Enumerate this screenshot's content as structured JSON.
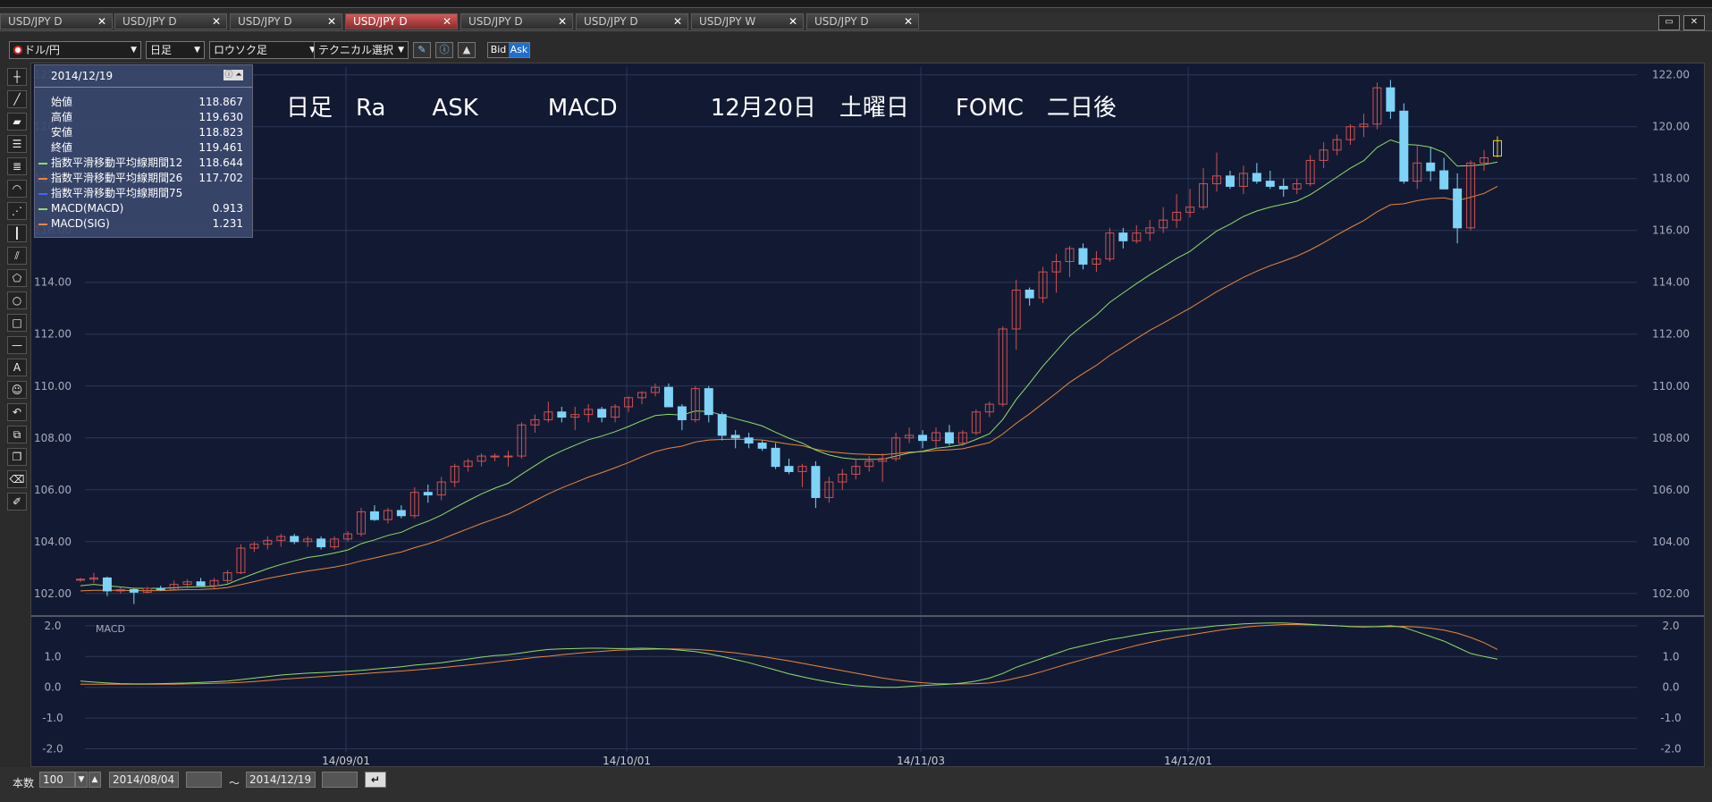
{
  "tabs": [
    {
      "label": "USD/JPY D",
      "active": false
    },
    {
      "label": "USD/JPY D",
      "active": false
    },
    {
      "label": "USD/JPY D",
      "active": false
    },
    {
      "label": "USD/JPY D",
      "active": true
    },
    {
      "label": "USD/JPY D",
      "active": false
    },
    {
      "label": "USD/JPY D",
      "active": false
    },
    {
      "label": "USD/JPY W",
      "active": false
    },
    {
      "label": "USD/JPY D",
      "active": false
    }
  ],
  "toolbar": {
    "pair": "ドル/円",
    "period": "日足",
    "chart_style": "ロウソク足",
    "technical": "テクニカル選択",
    "bid": "Bid",
    "ask": "Ask"
  },
  "info": {
    "date": "2014/12/19",
    "rows": [
      {
        "label": "始値",
        "value": "118.867",
        "color": ""
      },
      {
        "label": "高値",
        "value": "119.630",
        "color": ""
      },
      {
        "label": "安値",
        "value": "118.823",
        "color": ""
      },
      {
        "label": "終値",
        "value": "119.461",
        "color": ""
      },
      {
        "label": "指数平滑移動平均線期間12",
        "value": "118.644",
        "color": "#8fdc6a"
      },
      {
        "label": "指数平滑移動平均線期間26",
        "value": "117.702",
        "color": "#e8873a"
      },
      {
        "label": "指数平滑移動平均線期間75",
        "value": "",
        "color": "#4466ee"
      },
      {
        "label": "MACD(MACD)",
        "value": "0.913",
        "color": "#8fdc6a"
      },
      {
        "label": "MACD(SIG)",
        "value": "1.231",
        "color": "#e8873a"
      }
    ]
  },
  "annotation": "日足　Ra　　ASK　　　MACD　　　　12月20日　土曜日　　FOMC　二日後",
  "chart_data": {
    "type": "candlestick",
    "y_ticks": [
      "122.00",
      "120.00",
      "118.00",
      "116.00",
      "114.00",
      "112.00",
      "110.00",
      "108.00",
      "106.00",
      "104.00",
      "102.00"
    ],
    "ylim": [
      101.2,
      122.3
    ],
    "x_labels": [
      "14/09/01",
      "14/10/01",
      "14/11/03",
      "14/12/01"
    ],
    "candles": [
      [
        102.55,
        102.6,
        102.45,
        102.55
      ],
      [
        102.55,
        102.8,
        102.4,
        102.6
      ],
      [
        102.6,
        102.65,
        101.9,
        102.1
      ],
      [
        102.1,
        102.25,
        102.0,
        102.15
      ],
      [
        102.15,
        102.2,
        101.6,
        102.05
      ],
      [
        102.05,
        102.25,
        102.0,
        102.2
      ],
      [
        102.2,
        102.3,
        102.1,
        102.15
      ],
      [
        102.15,
        102.5,
        102.1,
        102.35
      ],
      [
        102.35,
        102.55,
        102.2,
        102.45
      ],
      [
        102.45,
        102.6,
        102.3,
        102.3
      ],
      [
        102.3,
        102.6,
        102.2,
        102.5
      ],
      [
        102.5,
        102.9,
        102.4,
        102.8
      ],
      [
        102.8,
        103.9,
        102.75,
        103.75
      ],
      [
        103.75,
        104.0,
        103.6,
        103.9
      ],
      [
        103.9,
        104.2,
        103.7,
        104.05
      ],
      [
        104.05,
        104.3,
        103.8,
        104.2
      ],
      [
        104.2,
        104.3,
        103.9,
        104.0
      ],
      [
        104.0,
        104.2,
        103.8,
        104.1
      ],
      [
        104.1,
        104.2,
        103.7,
        103.8
      ],
      [
        103.8,
        104.2,
        103.7,
        104.1
      ],
      [
        104.1,
        104.4,
        104.0,
        104.3
      ],
      [
        104.3,
        105.3,
        104.2,
        105.15
      ],
      [
        105.15,
        105.4,
        104.8,
        104.85
      ],
      [
        104.85,
        105.3,
        104.7,
        105.2
      ],
      [
        105.2,
        105.4,
        104.9,
        105.0
      ],
      [
        105.0,
        106.1,
        104.9,
        105.9
      ],
      [
        105.9,
        106.2,
        105.5,
        105.8
      ],
      [
        105.8,
        106.5,
        105.6,
        106.3
      ],
      [
        106.3,
        107.0,
        106.1,
        106.9
      ],
      [
        106.9,
        107.2,
        106.7,
        107.1
      ],
      [
        107.1,
        107.4,
        106.9,
        107.3
      ],
      [
        107.3,
        107.4,
        107.1,
        107.3
      ],
      [
        107.3,
        107.5,
        106.9,
        107.3
      ],
      [
        107.3,
        108.6,
        107.2,
        108.5
      ],
      [
        108.5,
        108.9,
        108.2,
        108.7
      ],
      [
        108.7,
        109.4,
        108.6,
        109.0
      ],
      [
        109.0,
        109.2,
        108.6,
        108.8
      ],
      [
        108.8,
        109.2,
        108.3,
        108.9
      ],
      [
        108.9,
        109.3,
        108.6,
        109.1
      ],
      [
        109.1,
        109.2,
        108.6,
        108.8
      ],
      [
        108.8,
        109.3,
        108.6,
        109.2
      ],
      [
        109.2,
        109.6,
        109.0,
        109.55
      ],
      [
        109.55,
        109.8,
        109.3,
        109.75
      ],
      [
        109.75,
        110.1,
        109.6,
        109.95
      ],
      [
        109.95,
        110.1,
        109.2,
        109.2
      ],
      [
        109.2,
        109.3,
        108.3,
        108.7
      ],
      [
        108.7,
        110.0,
        108.6,
        109.9
      ],
      [
        109.9,
        110.0,
        108.6,
        108.9
      ],
      [
        108.9,
        109.0,
        107.9,
        108.1
      ],
      [
        108.1,
        108.3,
        107.6,
        108.0
      ],
      [
        108.0,
        108.2,
        107.6,
        107.8
      ],
      [
        107.8,
        107.9,
        107.5,
        107.6
      ],
      [
        107.6,
        107.8,
        106.8,
        106.9
      ],
      [
        106.9,
        107.2,
        106.6,
        106.7
      ],
      [
        106.7,
        107.0,
        106.1,
        106.9
      ],
      [
        106.9,
        107.1,
        105.3,
        105.7
      ],
      [
        105.7,
        106.5,
        105.5,
        106.3
      ],
      [
        106.3,
        106.8,
        106.0,
        106.6
      ],
      [
        106.6,
        107.2,
        106.4,
        106.9
      ],
      [
        106.9,
        107.3,
        106.7,
        107.1
      ],
      [
        107.1,
        107.4,
        106.3,
        107.2
      ],
      [
        107.2,
        108.2,
        107.1,
        108.0
      ],
      [
        108.0,
        108.4,
        107.8,
        108.1
      ],
      [
        108.1,
        108.3,
        107.6,
        107.9
      ],
      [
        107.9,
        108.4,
        107.6,
        108.2
      ],
      [
        108.2,
        108.5,
        107.7,
        107.8
      ],
      [
        107.8,
        108.3,
        107.7,
        108.2
      ],
      [
        108.2,
        109.1,
        108.1,
        109.0
      ],
      [
        109.0,
        109.4,
        108.8,
        109.3
      ],
      [
        109.3,
        112.3,
        109.2,
        112.2
      ],
      [
        112.2,
        114.1,
        111.4,
        113.7
      ],
      [
        113.7,
        113.8,
        113.1,
        113.4
      ],
      [
        113.4,
        114.6,
        113.2,
        114.4
      ],
      [
        114.4,
        115.1,
        113.6,
        114.8
      ],
      [
        114.8,
        115.4,
        114.2,
        115.3
      ],
      [
        115.3,
        115.5,
        114.5,
        114.7
      ],
      [
        114.7,
        115.2,
        114.4,
        114.9
      ],
      [
        114.9,
        116.1,
        114.8,
        115.9
      ],
      [
        115.9,
        116.1,
        115.3,
        115.6
      ],
      [
        115.6,
        116.2,
        115.5,
        115.9
      ],
      [
        115.9,
        116.4,
        115.6,
        116.1
      ],
      [
        116.1,
        116.9,
        115.9,
        116.4
      ],
      [
        116.4,
        117.4,
        116.1,
        116.7
      ],
      [
        116.7,
        117.6,
        116.5,
        116.9
      ],
      [
        116.9,
        118.4,
        116.8,
        117.8
      ],
      [
        117.8,
        119.0,
        117.5,
        118.1
      ],
      [
        118.1,
        118.3,
        117.6,
        117.7
      ],
      [
        117.7,
        118.5,
        117.4,
        118.2
      ],
      [
        118.2,
        118.6,
        117.8,
        117.9
      ],
      [
        117.9,
        118.3,
        117.6,
        117.7
      ],
      [
        117.7,
        118.0,
        117.3,
        117.6
      ],
      [
        117.6,
        118.0,
        117.4,
        117.8
      ],
      [
        117.8,
        118.9,
        117.7,
        118.7
      ],
      [
        118.7,
        119.4,
        118.4,
        119.1
      ],
      [
        119.1,
        119.7,
        118.9,
        119.5
      ],
      [
        119.5,
        120.1,
        119.3,
        120.0
      ],
      [
        120.0,
        120.5,
        119.6,
        120.1
      ],
      [
        120.1,
        121.7,
        119.9,
        121.5
      ],
      [
        121.5,
        121.8,
        120.3,
        120.6
      ],
      [
        120.6,
        120.9,
        117.8,
        117.9
      ],
      [
        117.9,
        119.3,
        117.6,
        118.6
      ],
      [
        118.6,
        119.2,
        117.9,
        118.3
      ],
      [
        118.3,
        118.8,
        117.6,
        117.6
      ],
      [
        117.6,
        118.2,
        115.5,
        116.1
      ],
      [
        116.1,
        118.7,
        116.0,
        118.6
      ],
      [
        118.6,
        119.1,
        118.3,
        118.8
      ],
      [
        118.867,
        119.63,
        118.823,
        119.461
      ]
    ],
    "ema12": [
      102.3,
      102.35,
      102.3,
      102.25,
      102.2,
      102.2,
      102.2,
      102.22,
      102.25,
      102.26,
      102.28,
      102.36,
      102.57,
      102.77,
      102.96,
      103.12,
      103.26,
      103.39,
      103.46,
      103.56,
      103.68,
      103.92,
      104.07,
      104.24,
      104.36,
      104.6,
      104.79,
      105.02,
      105.31,
      105.58,
      105.84,
      106.06,
      106.25,
      106.6,
      106.93,
      107.25,
      107.5,
      107.72,
      107.93,
      108.07,
      108.24,
      108.44,
      108.66,
      108.86,
      108.91,
      108.88,
      109.04,
      109.02,
      108.88,
      108.74,
      108.61,
      108.46,
      108.22,
      107.99,
      107.8,
      107.53,
      107.34,
      107.23,
      107.18,
      107.17,
      107.18,
      107.3,
      107.42,
      107.49,
      107.6,
      107.66,
      107.74,
      107.94,
      108.16,
      108.71,
      109.48,
      110.11,
      110.77,
      111.35,
      111.93,
      112.35,
      112.74,
      113.23,
      113.59,
      113.95,
      114.29,
      114.6,
      114.92,
      115.19,
      115.59,
      115.98,
      116.24,
      116.54,
      116.75,
      116.9,
      117.01,
      117.13,
      117.38,
      117.71,
      118.06,
      118.4,
      118.69,
      119.2,
      119.49,
      119.32,
      119.29,
      119.21,
      119.0,
      118.48,
      118.5,
      118.54,
      118.64
    ],
    "ema26": [
      102.1,
      102.12,
      102.12,
      102.12,
      102.11,
      102.11,
      102.11,
      102.13,
      102.15,
      102.16,
      102.18,
      102.23,
      102.34,
      102.46,
      102.58,
      102.68,
      102.78,
      102.87,
      102.94,
      103.02,
      103.12,
      103.26,
      103.37,
      103.49,
      103.6,
      103.77,
      103.91,
      104.09,
      104.3,
      104.5,
      104.7,
      104.88,
      105.06,
      105.31,
      105.58,
      105.84,
      106.07,
      106.28,
      106.49,
      106.66,
      106.85,
      107.05,
      107.27,
      107.47,
      107.6,
      107.68,
      107.84,
      107.92,
      107.94,
      107.95,
      107.94,
      107.92,
      107.84,
      107.76,
      107.7,
      107.56,
      107.47,
      107.42,
      107.38,
      107.36,
      107.35,
      107.4,
      107.45,
      107.47,
      107.52,
      107.54,
      107.58,
      107.7,
      107.82,
      108.15,
      108.56,
      108.93,
      109.33,
      109.73,
      110.14,
      110.48,
      110.8,
      111.18,
      111.5,
      111.83,
      112.15,
      112.43,
      112.72,
      113.0,
      113.32,
      113.64,
      113.91,
      114.19,
      114.43,
      114.64,
      114.82,
      115.01,
      115.25,
      115.53,
      115.83,
      116.11,
      116.38,
      116.72,
      116.99,
      117.03,
      117.15,
      117.23,
      117.26,
      117.15,
      117.28,
      117.43,
      117.7
    ],
    "macd": [
      0.2,
      0.17,
      0.14,
      0.12,
      0.11,
      0.11,
      0.12,
      0.13,
      0.14,
      0.16,
      0.18,
      0.2,
      0.25,
      0.3,
      0.35,
      0.4,
      0.43,
      0.46,
      0.48,
      0.5,
      0.52,
      0.55,
      0.59,
      0.63,
      0.67,
      0.72,
      0.76,
      0.8,
      0.86,
      0.92,
      0.98,
      1.03,
      1.06,
      1.12,
      1.18,
      1.23,
      1.25,
      1.26,
      1.27,
      1.27,
      1.26,
      1.26,
      1.27,
      1.26,
      1.24,
      1.2,
      1.16,
      1.09,
      1.0,
      0.9,
      0.8,
      0.68,
      0.56,
      0.44,
      0.34,
      0.25,
      0.17,
      0.1,
      0.05,
      0.02,
      0.0,
      0.0,
      0.03,
      0.06,
      0.08,
      0.1,
      0.14,
      0.2,
      0.3,
      0.45,
      0.65,
      0.8,
      0.95,
      1.1,
      1.25,
      1.35,
      1.45,
      1.55,
      1.62,
      1.7,
      1.77,
      1.83,
      1.87,
      1.91,
      1.95,
      2.0,
      2.03,
      2.06,
      2.08,
      2.09,
      2.09,
      2.07,
      2.05,
      2.02,
      2.0,
      1.97,
      1.96,
      1.97,
      2.0,
      1.95,
      1.8,
      1.65,
      1.5,
      1.3,
      1.1,
      1.0,
      0.913
    ],
    "signal": [
      0.1,
      0.1,
      0.1,
      0.1,
      0.1,
      0.1,
      0.1,
      0.1,
      0.11,
      0.12,
      0.13,
      0.14,
      0.16,
      0.19,
      0.22,
      0.26,
      0.29,
      0.32,
      0.35,
      0.38,
      0.41,
      0.44,
      0.47,
      0.5,
      0.53,
      0.56,
      0.6,
      0.64,
      0.68,
      0.72,
      0.77,
      0.82,
      0.87,
      0.92,
      0.97,
      1.01,
      1.06,
      1.1,
      1.14,
      1.17,
      1.2,
      1.22,
      1.23,
      1.24,
      1.25,
      1.24,
      1.23,
      1.2,
      1.16,
      1.12,
      1.06,
      1.0,
      0.93,
      0.86,
      0.78,
      0.7,
      0.62,
      0.54,
      0.46,
      0.38,
      0.3,
      0.24,
      0.19,
      0.15,
      0.12,
      0.11,
      0.11,
      0.12,
      0.14,
      0.2,
      0.3,
      0.4,
      0.52,
      0.65,
      0.78,
      0.9,
      1.02,
      1.14,
      1.25,
      1.36,
      1.46,
      1.55,
      1.63,
      1.7,
      1.77,
      1.84,
      1.9,
      1.95,
      1.99,
      2.02,
      2.04,
      2.04,
      2.03,
      2.02,
      2.0,
      1.98,
      1.97,
      1.97,
      1.97,
      1.98,
      1.96,
      1.92,
      1.86,
      1.76,
      1.62,
      1.45,
      1.231
    ],
    "macd_label": "MACD",
    "macd_ticks": [
      "2.0",
      "1.0",
      "0.0",
      "-1.0",
      "-2.0"
    ],
    "macd_ylim": [
      -2.1,
      2.2
    ]
  },
  "bottom": {
    "count_label": "本数",
    "count_value": "100",
    "start_date": "2014/08/04",
    "tilde": "〜",
    "end_date": "2014/12/19"
  }
}
